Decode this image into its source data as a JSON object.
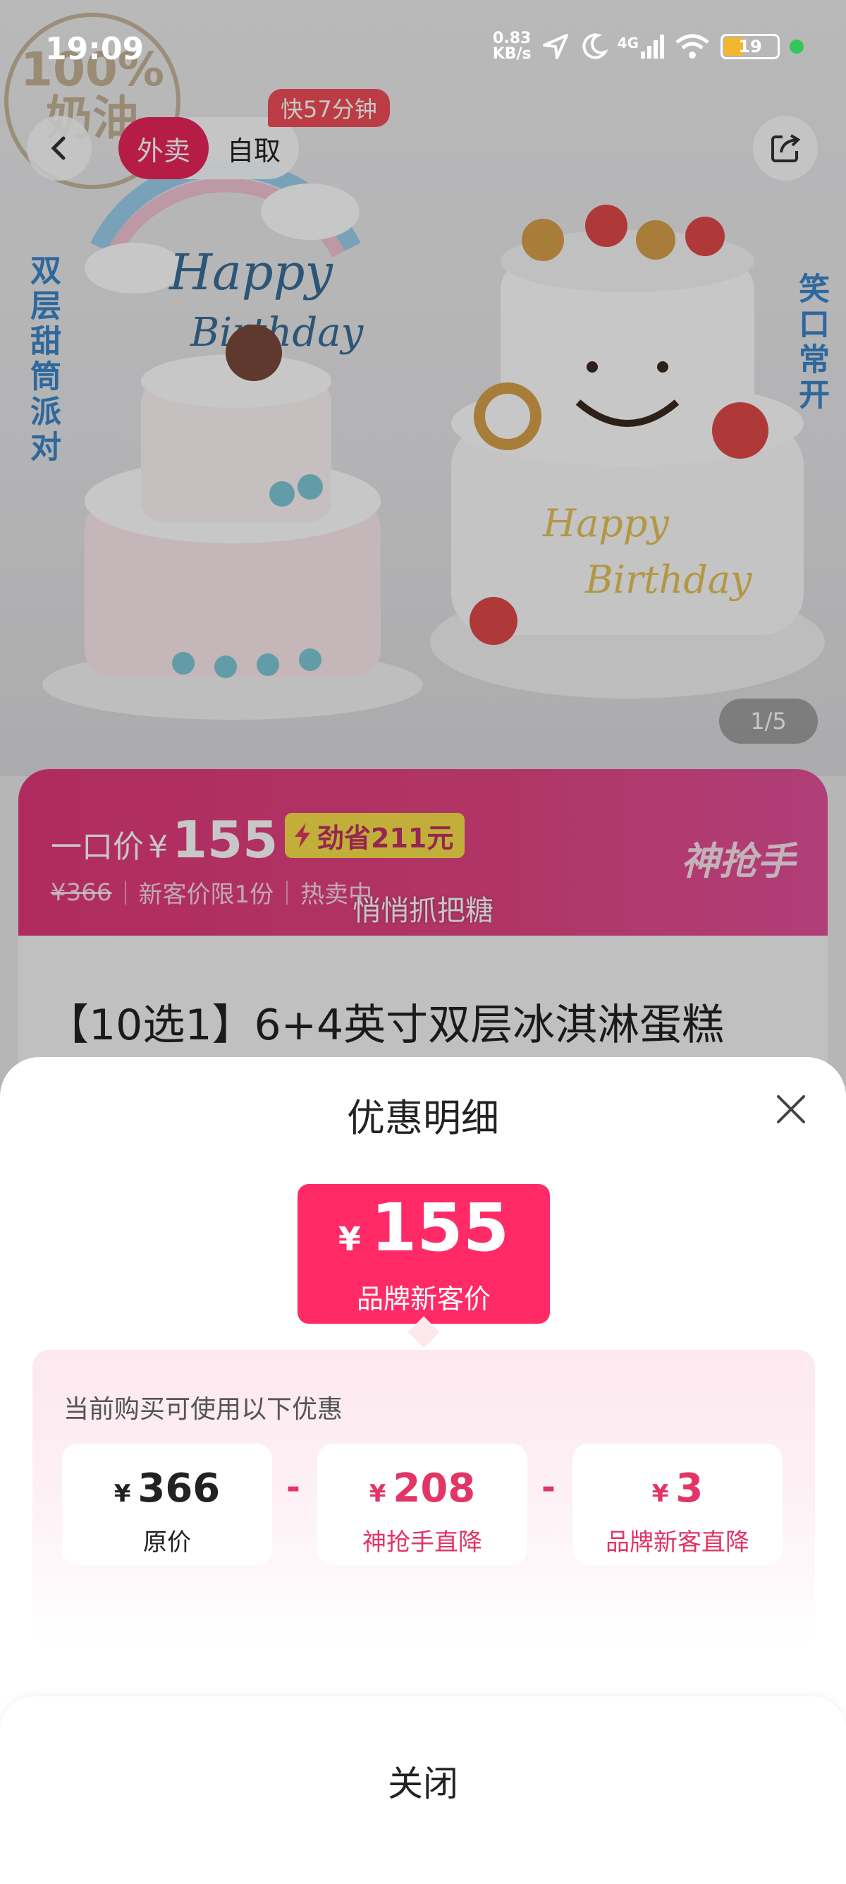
{
  "status": {
    "time": "19:09",
    "net_speed": "0.83",
    "net_unit": "KB/s",
    "network": "4G",
    "battery": "19"
  },
  "nav": {
    "mode_delivery": "外卖",
    "mode_pickup": "自取",
    "eta": "快57分钟"
  },
  "hero": {
    "left_tagline": "双层甜筒派对",
    "right_tagline": "笑口常开",
    "stamp_text": "100%\n奶油",
    "page_indicator": "1/5"
  },
  "banner": {
    "one_price_label": "一口价",
    "currency": "¥",
    "price": "155",
    "save_text": "劲省211元",
    "original_price": "¥366",
    "limit_text": "新客价限1份",
    "hot_text": "热卖中",
    "brand": "神抢手",
    "ticker": "悄悄抓把糖"
  },
  "product": {
    "title": "【10选1】6+4英寸双层冰淇淋蛋糕"
  },
  "sheet": {
    "title": "优惠明细",
    "price_currency": "¥",
    "price": "155",
    "price_label": "品牌新客价",
    "hint": "当前购买可使用以下优惠",
    "items": [
      {
        "currency": "¥",
        "amount": "366",
        "label": "原价"
      },
      {
        "currency": "¥",
        "amount": "208",
        "label": "神抢手直降"
      },
      {
        "currency": "¥",
        "amount": "3",
        "label": "品牌新客直降"
      }
    ],
    "operator": "-",
    "close_label": "关闭"
  },
  "colors": {
    "accent": "#ff2a66",
    "banner": "#e2387a",
    "save_pill": "#f8e04a"
  }
}
